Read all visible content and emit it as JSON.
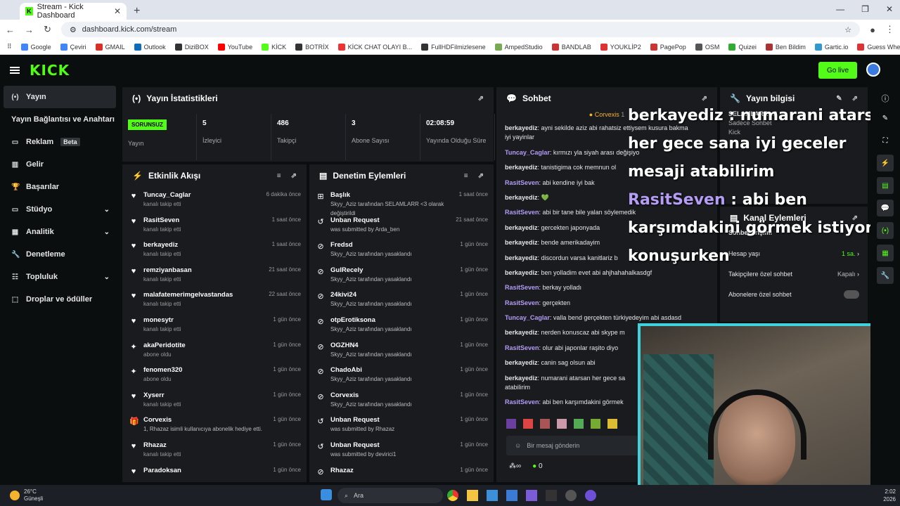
{
  "browser": {
    "tab_title": "Stream - Kick Dashboard",
    "url": "dashboard.kick.com/stream",
    "bookmarks": [
      "Google",
      "Çeviri",
      "GMAIL",
      "Outlook",
      "DiziBOX",
      "YouTube",
      "KİCK",
      "BOTRİX",
      "KİCK CHAT OLAYI B...",
      "FullHDFilmizlesene",
      "AmpedStudio",
      "BANDLAB",
      "YOUKLİP2",
      "PagePop",
      "OSM",
      "Quizei",
      "Ben Bildim",
      "Gartic.io",
      "Guess Where You Are"
    ]
  },
  "header": {
    "logo": "KICK",
    "golive": "Go live"
  },
  "sidebar": [
    {
      "label": "Yayın",
      "icon": "(•)"
    },
    {
      "label": "Yayın Bağlantısı ve Anahtarı",
      "icon": ""
    },
    {
      "label": "Reklam",
      "icon": "▭",
      "badge": "Beta"
    },
    {
      "label": "Gelir",
      "icon": "▥"
    },
    {
      "label": "Başarılar",
      "icon": "🏆"
    },
    {
      "label": "Stüdyo",
      "icon": "▭"
    },
    {
      "label": "Analitik",
      "icon": "▦"
    },
    {
      "label": "Denetleme",
      "icon": "🔧"
    },
    {
      "label": "Topluluk",
      "icon": "☷"
    },
    {
      "label": "Droplar ve ödüller",
      "icon": "⬚"
    }
  ],
  "stats": {
    "title": "Yayın İstatistikleri",
    "status": "SORUNSUZ",
    "items": [
      {
        "value": "",
        "label": "Yayın"
      },
      {
        "value": "5",
        "label": "İzleyici"
      },
      {
        "value": "486",
        "label": "Takipçi"
      },
      {
        "value": "3",
        "label": "Abone Sayısı"
      },
      {
        "value": "02:08:59",
        "label": "Yayında Olduğu Süre"
      }
    ]
  },
  "activity": {
    "title": "Etkinlik Akışı",
    "rows": [
      {
        "name": "Tuncay_Caglar",
        "sub": "kanalı takip etti",
        "time": "6 dakika önce",
        "icon": "♥"
      },
      {
        "name": "RasitSeven",
        "sub": "kanalı takip etti",
        "time": "1 saat önce",
        "icon": "♥"
      },
      {
        "name": "berkayediz",
        "sub": "kanalı takip etti",
        "time": "1 saat önce",
        "icon": "♥"
      },
      {
        "name": "remziyanbasan",
        "sub": "kanalı takip etti",
        "time": "21 saat önce",
        "icon": "♥"
      },
      {
        "name": "malafatemerimgelvastandas",
        "sub": "kanalı takip etti",
        "time": "22 saat önce",
        "icon": "♥"
      },
      {
        "name": "monesytr",
        "sub": "kanalı takip etti",
        "time": "1 gün önce",
        "icon": "♥"
      },
      {
        "name": "akaPeridotite",
        "sub": "abone oldu",
        "time": "1 gün önce",
        "icon": "✦"
      },
      {
        "name": "fenomen320",
        "sub": "abone oldu",
        "time": "1 gün önce",
        "icon": "✦"
      },
      {
        "name": "Xyserr",
        "sub": "kanalı takip etti",
        "time": "1 gün önce",
        "icon": "♥"
      },
      {
        "name": "Corvexis",
        "sub": "1, Rhazaz isimli kullanıcıya abonelik hediye etti.",
        "time": "1 gün önce",
        "icon": "🎁"
      },
      {
        "name": "Rhazaz",
        "sub": "kanalı takip etti",
        "time": "1 gün önce",
        "icon": "♥"
      },
      {
        "name": "Paradoksan",
        "sub": "",
        "time": "1 gün önce",
        "icon": "♥"
      }
    ]
  },
  "moderation": {
    "title": "Denetim Eylemleri",
    "rows": [
      {
        "name": "Başlık",
        "sub": "Skyy_Aziz tarafından SELAMLARR <3 olarak değiştirildi",
        "time": "1 saat önce",
        "icon": "⊞"
      },
      {
        "name": "Unban Request",
        "sub": "was submitted by Arda_ben",
        "time": "21 saat önce",
        "icon": "↺"
      },
      {
        "name": "Fredsd",
        "sub": "Skyy_Aziz tarafından yasaklandı",
        "time": "1 gün önce",
        "icon": "⊘"
      },
      {
        "name": "GulRecely",
        "sub": "Skyy_Aziz tarafından yasaklandı",
        "time": "1 gün önce",
        "icon": "⊘"
      },
      {
        "name": "24kivi24",
        "sub": "Skyy_Aziz tarafından yasaklandı",
        "time": "1 gün önce",
        "icon": "⊘"
      },
      {
        "name": "otpErotiksona",
        "sub": "Skyy_Aziz tarafından yasaklandı",
        "time": "1 gün önce",
        "icon": "⊘"
      },
      {
        "name": "OGZHN4",
        "sub": "Skyy_Aziz tarafından yasaklandı",
        "time": "1 gün önce",
        "icon": "⊘"
      },
      {
        "name": "ChadoAbi",
        "sub": "Skyy_Aziz tarafından yasaklandı",
        "time": "1 gün önce",
        "icon": "⊘"
      },
      {
        "name": "Corvexis",
        "sub": "Skyy_Aziz tarafından yasaklandı",
        "time": "1 gün önce",
        "icon": "⊘"
      },
      {
        "name": "Unban Request",
        "sub": "was submitted by Rhazaz",
        "time": "1 gün önce",
        "icon": "↺"
      },
      {
        "name": "Unban Request",
        "sub": "was submitted by devirici1",
        "time": "1 gün önce",
        "icon": "↺"
      },
      {
        "name": "Rhazaz",
        "sub": "",
        "time": "1 gün önce",
        "icon": "⊘"
      }
    ]
  },
  "chat": {
    "title": "Sohbet",
    "pinned": "Corvexis",
    "pinned_count": "1",
    "input_placeholder": "Bir mesaj gönderin",
    "footer_count": "0",
    "messages": [
      {
        "user": "berkayediz",
        "text": ": ayni sekilde aziz abi rahatsiz ettiysem kusura bakma",
        "color": "#e6e6e6"
      },
      {
        "user": "",
        "text": "iyi yayinlar",
        "color": "#e6e6e6"
      },
      {
        "user": "Tuncay_Caglar",
        "text": ": kırmızı yla siyah arası değişiyo",
        "color": "#b59cf5"
      },
      {
        "user": "berkayediz",
        "text": ": tanistigima cok memnun ol",
        "color": "#e6e6e6"
      },
      {
        "user": "RasitSeven",
        "text": ": abi kendine iyi bak",
        "color": "#b59cf5"
      },
      {
        "user": "berkayediz",
        "text": ": 💚",
        "color": "#e6e6e6"
      },
      {
        "user": "RasitSeven",
        "text": ": abi bir tane bile yalan söylemedik",
        "color": "#b59cf5"
      },
      {
        "user": "berkayediz",
        "text": ": gercekten japonyada",
        "color": "#e6e6e6"
      },
      {
        "user": "berkayediz",
        "text": ": bende amerikadayim",
        "color": "#e6e6e6"
      },
      {
        "user": "berkayediz",
        "text": ": discordun varsa kanitlariz b",
        "color": "#e6e6e6"
      },
      {
        "user": "berkayediz",
        "text": ": ben yolladim evet abi ahjhahahalkasdgf",
        "color": "#e6e6e6"
      },
      {
        "user": "RasitSeven",
        "text": ": berkay yolladı",
        "color": "#b59cf5"
      },
      {
        "user": "RasitSeven",
        "text": ": gerçekten",
        "color": "#b59cf5"
      },
      {
        "user": "Tuncay_Caglar",
        "text": ": valla bend gerçekten türkiyedeyim abi asdasd",
        "color": "#b59cf5"
      },
      {
        "user": "berkayediz",
        "text": ": nerden konuscaz abi skype m",
        "color": "#e6e6e6"
      },
      {
        "user": "RasitSeven",
        "text": ": olur abi japonlar raşito diyo",
        "color": "#b59cf5"
      },
      {
        "user": "berkayediz",
        "text": ": canin sag olsun abi",
        "color": "#e6e6e6"
      },
      {
        "user": "berkayediz",
        "text": ": numarani atarsan her gece sa",
        "color": "#e6e6e6"
      },
      {
        "user": "",
        "text": "atabilirim",
        "color": "#e6e6e6"
      },
      {
        "user": "RasitSeven",
        "text": ": abi ben karşımdakini görmek",
        "color": "#b59cf5"
      }
    ]
  },
  "info": {
    "title": "Yayın bilgisi",
    "stream_title": "SELAMLARR <3",
    "category": "Sadece Sohbet",
    "extra": "Kick"
  },
  "channel": {
    "title": "Kanal Eylemleri",
    "section": "Sohbet erişimi",
    "rows": [
      {
        "label": "Hesap yaşı",
        "value": "1 sa."
      },
      {
        "label": "Takipçilere özel sohbet",
        "value": "Kapalı"
      },
      {
        "label": "Abonelere özel sohbet",
        "value": ""
      }
    ]
  },
  "overlay": {
    "line1_user": "berkayediz",
    "line1_text": " : numarani atarsan her gece sana iyi geceler mesaji atabilirim",
    "line2_user": "RasitSeven",
    "line2_text": " : abi ben karşımdakini görmek istiyom konuşurken"
  },
  "taskbar": {
    "temp": "26°C",
    "weather": "Güneşli",
    "search": "Ara",
    "time": "2:02",
    "date": "2026"
  }
}
